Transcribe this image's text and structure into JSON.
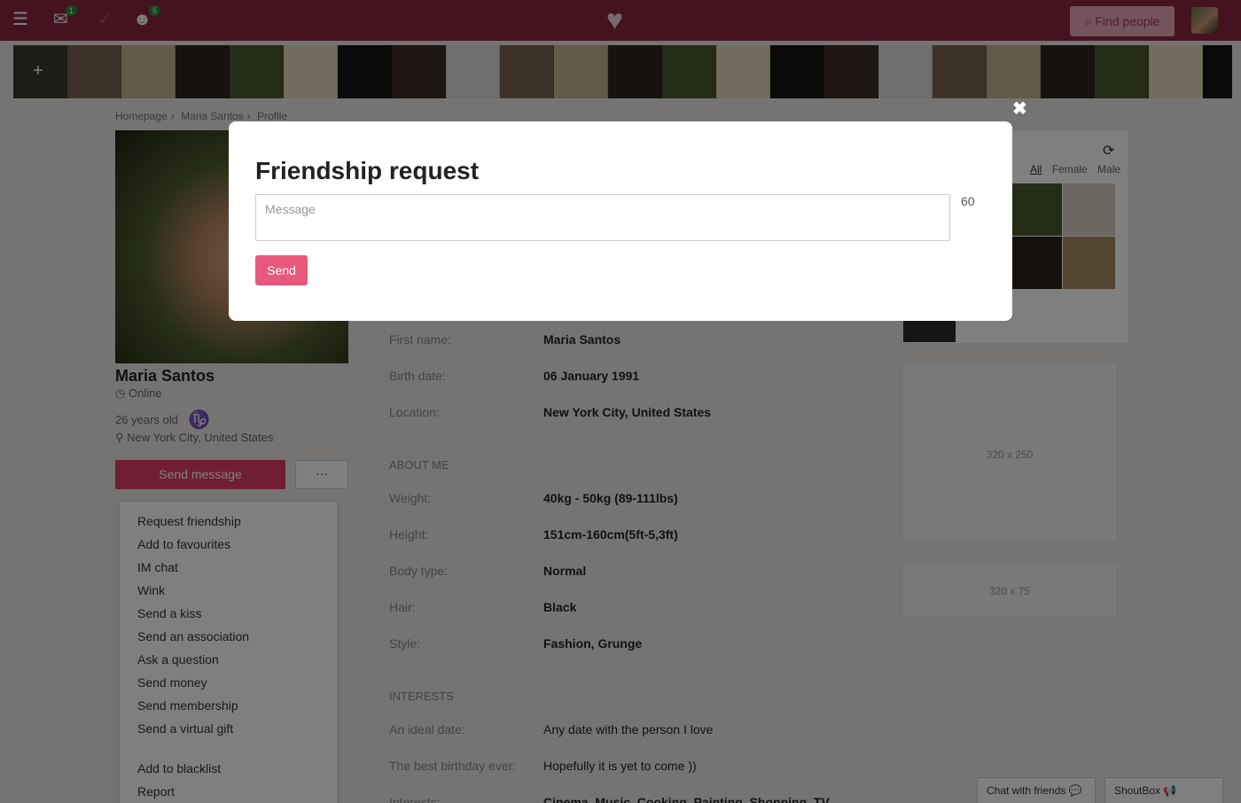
{
  "topbar": {
    "messages_badge": "1",
    "friends_badge": "5",
    "find_people": "Find people"
  },
  "breadcrumb": [
    "Homepage",
    "Maria Santos",
    "Profile"
  ],
  "profile": {
    "name": "Maria Santos",
    "status": "Online",
    "age": "26 years old",
    "location": "New York City, United States",
    "send_message": "Send message",
    "more": "···"
  },
  "menu": {
    "items": [
      "Request friendship",
      "Add to favourites",
      "IM chat",
      "Wink",
      "Send a kiss",
      "Send an association",
      "Ask a question",
      "Send money",
      "Send membership",
      "Send a virtual gift"
    ],
    "extra": [
      "Add to blacklist",
      "Report"
    ]
  },
  "info": {
    "first_name": {
      "label": "First name:",
      "value": "Maria Santos"
    },
    "birth_date": {
      "label": "Birth date:",
      "value": "06 January 1991"
    },
    "location": {
      "label": "Location:",
      "value": "New York City, United States"
    },
    "about_title": "ABOUT ME",
    "weight": {
      "label": "Weight:",
      "value": "40kg - 50kg (89-111lbs)"
    },
    "height": {
      "label": "Height:",
      "value": "151cm-160cm(5ft-5,3ft)"
    },
    "body_type": {
      "label": "Body type:",
      "value": "Normal"
    },
    "hair": {
      "label": "Hair:",
      "value": "Black"
    },
    "style": {
      "label": "Style:",
      "value": "Fashion, Grunge"
    },
    "interests_title": "INTERESTS",
    "ideal_date": {
      "label": "An ideal date:",
      "value": "Any date with the person I love"
    },
    "birthday": {
      "label": "The best birthday ever:",
      "value": "Hopefully it is yet to come ))"
    },
    "interests": {
      "label": "Interests:",
      "value": "Cinema, Music, Cooking, Painting, Shopping, TV"
    }
  },
  "side": {
    "tabs": [
      "All",
      "Female",
      "Male"
    ],
    "ad1": "320 x 250",
    "ad2": "320 x 75"
  },
  "bottom": {
    "chat": "Chat with friends",
    "shoutbox": "ShoutBox"
  },
  "modal": {
    "title": "Friendship request",
    "placeholder": "Message",
    "counter": "60",
    "send": "Send"
  }
}
